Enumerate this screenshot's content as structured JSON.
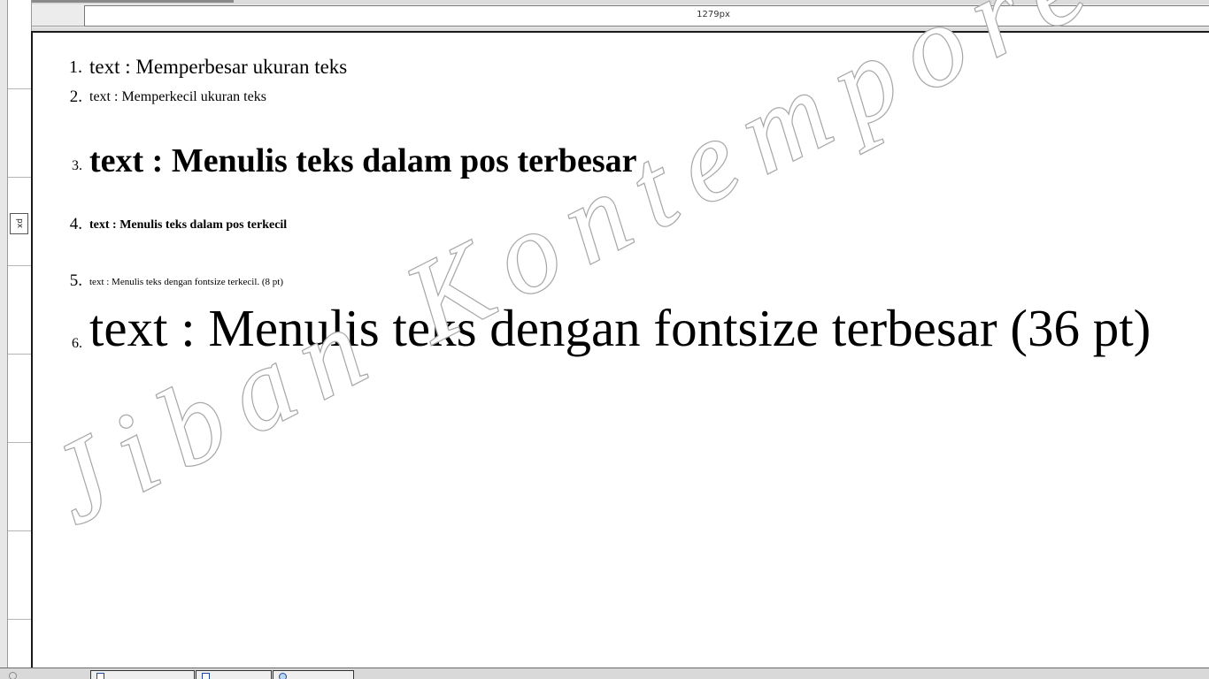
{
  "ruler": {
    "horizontal_label": "1279px",
    "vertical_label": "px"
  },
  "list": [
    {
      "number": "1.",
      "text": "text : Memperbesar ukuran teks"
    },
    {
      "number": "2.",
      "text": "text : Memperkecil ukuran teks"
    },
    {
      "number": "3.",
      "text": "text : Menulis teks dalam pos terbesar"
    },
    {
      "number": "4.",
      "text": "text : Menulis teks dalam pos terkecil"
    },
    {
      "number": "5.",
      "text": "text : Menulis teks dengan fontsize terkecil. (8 pt)"
    },
    {
      "number": "6.",
      "text": "text : Menulis teks dengan fontsize terbesar (36 pt)"
    }
  ],
  "watermark": {
    "text": "Jiban Kontemporer"
  },
  "bottom_tabs": [
    {
      "label": "",
      "icon": "view-icon"
    },
    {
      "label": "",
      "icon": "html-document-icon"
    },
    {
      "label": "",
      "icon": "design-document-icon"
    },
    {
      "label": "",
      "icon": "preview-globe-icon"
    }
  ],
  "colors": {
    "canvas": "#ffffff",
    "chrome": "#f0f0f0",
    "watermark_outline": "#a8a8a8"
  }
}
